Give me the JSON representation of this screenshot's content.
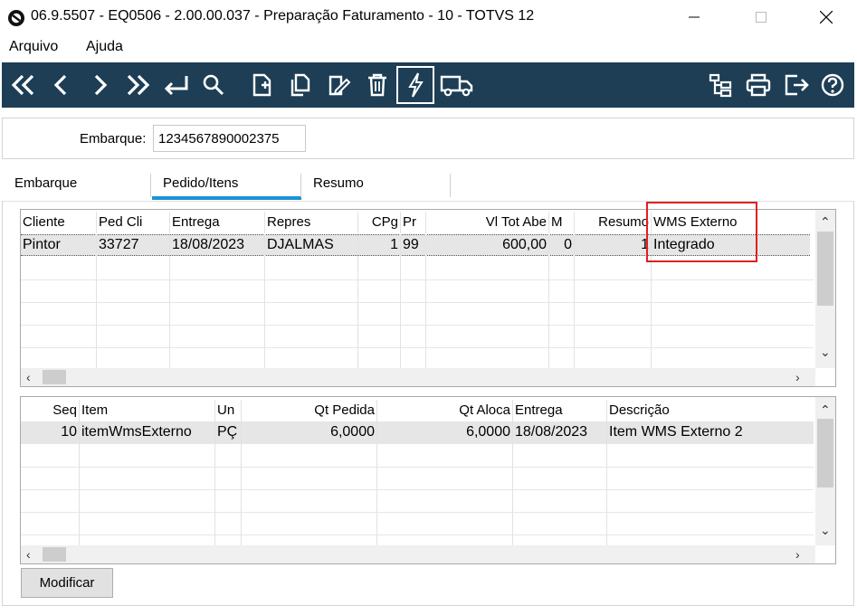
{
  "window": {
    "title": "06.9.5507 - EQ0506 - 2.00.00.037 - Preparação Faturamento - 10 - TOTVS 12"
  },
  "menu": {
    "items": [
      "Arquivo",
      "Ajuda"
    ]
  },
  "toolbar": {
    "left_icons": [
      "first-icon",
      "previous-icon",
      "next-icon",
      "last-icon",
      "goto-icon",
      "search-icon",
      "new-document-icon",
      "copy-icon",
      "edit-icon",
      "delete-icon",
      "lightning-icon",
      "truck-icon"
    ],
    "right_icons": [
      "tree-icon",
      "print-icon",
      "exit-icon",
      "help-icon"
    ],
    "bg_color": "#1d3e55"
  },
  "form": {
    "embarque_label": "Embarque:",
    "embarque_value": "1234567890002375"
  },
  "tabs": [
    "Embarque",
    "Pedido/Itens",
    "Resumo"
  ],
  "tabs_active": "Pedido/Itens",
  "orders_grid": {
    "columns": [
      "Cliente",
      "Ped Cli",
      "Entrega",
      "Repres",
      "CPg",
      "Pr",
      "Vl Tot Abe",
      "M",
      "Resumo",
      "WMS Externo"
    ],
    "rows": [
      [
        "Pintor",
        "33727",
        "18/08/2023",
        "DJALMAS",
        "1",
        "99",
        "600,00",
        "0",
        "1",
        "Integrado"
      ]
    ]
  },
  "items_grid": {
    "columns": [
      "Seq",
      "Item",
      "Un",
      "Qt Pedida",
      "Qt Aloca",
      "Entrega",
      "Descrição"
    ],
    "rows": [
      [
        "10",
        "itemWmsExterno",
        "PÇ",
        "6,0000",
        "6,0000",
        "18/08/2023",
        "Item WMS Externo 2"
      ]
    ]
  },
  "buttons": {
    "modificar": "Modificar"
  },
  "colors": {
    "highlight": "#e02020",
    "tab_accent": "#1a93d4"
  }
}
